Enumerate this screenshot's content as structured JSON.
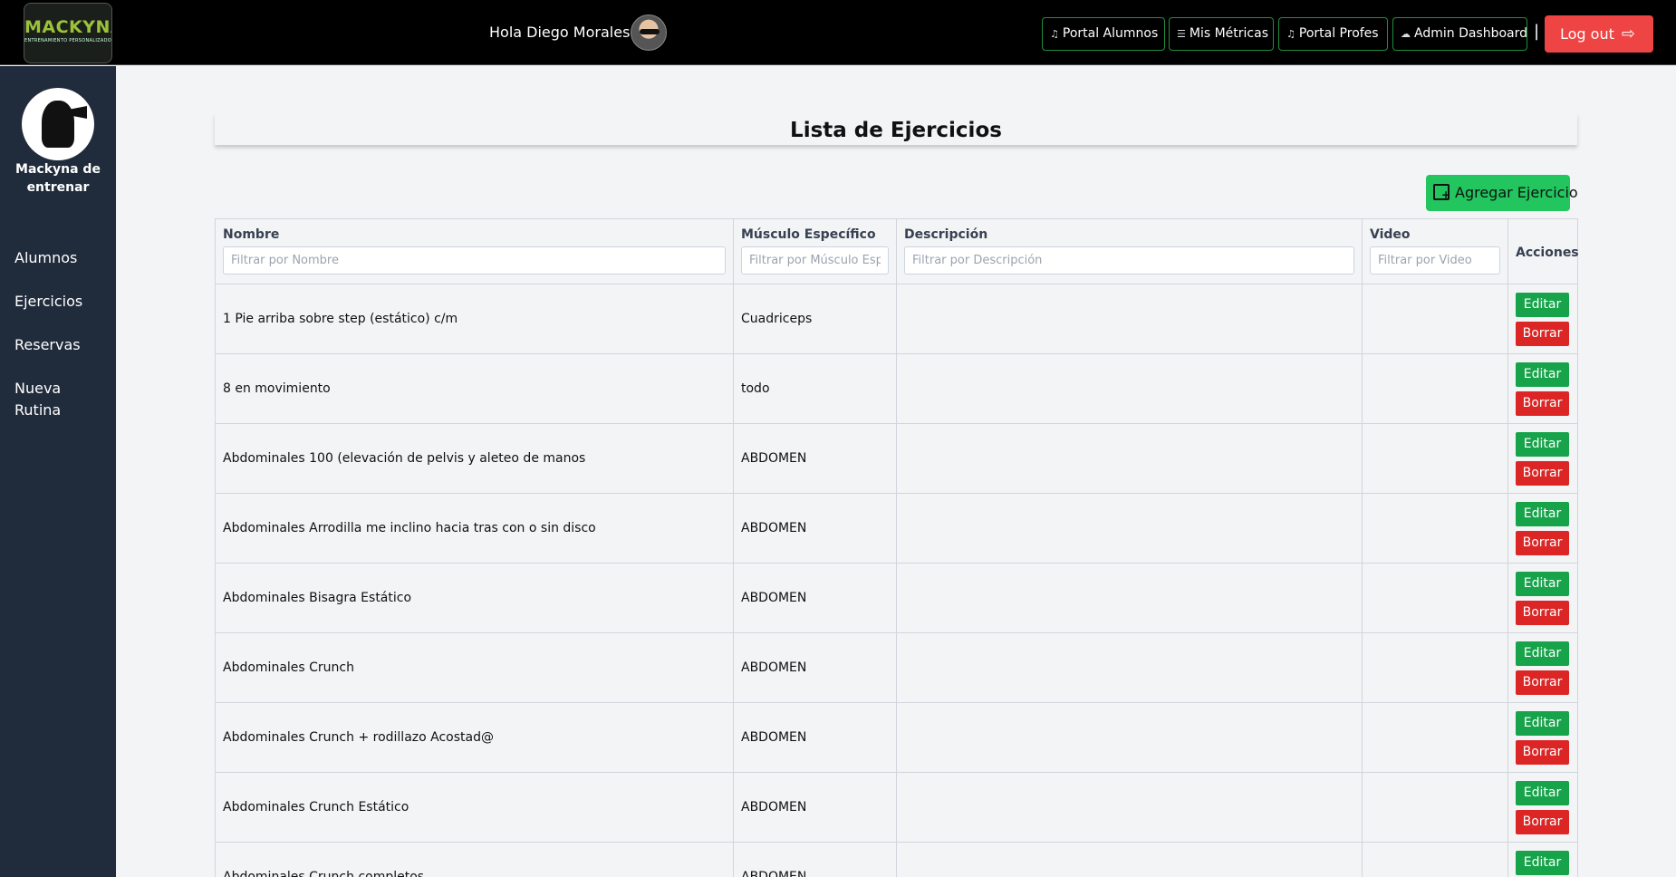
{
  "header": {
    "logo_text": "MACKYNA",
    "logo_tagline": "ENTRENAMIENTO PERSONALIZADO",
    "greeting": "Hola Diego Morales!",
    "nav": [
      {
        "label": "Portal Alumnos",
        "icon": "music-note-icon"
      },
      {
        "label": "Mis Métricas",
        "icon": "menu-lines-icon"
      },
      {
        "label": "Portal Profes",
        "icon": "music-note-icon"
      },
      {
        "label": "Admin Dashboard",
        "icon": "cloud-icon"
      }
    ],
    "separator": "|",
    "logout_label": "Log out",
    "colors": {
      "accent_green": "#1f8f3d",
      "logout": "#ef4444"
    }
  },
  "sidebar": {
    "name": "Mackyna de entrenar",
    "items": [
      {
        "label": "Alumnos"
      },
      {
        "label": "Ejercicios"
      },
      {
        "label": "Reservas"
      },
      {
        "label": "Nueva Rutina"
      }
    ]
  },
  "main": {
    "title": "Lista de Ejercicios",
    "add_label": "Agregar Ejercicio",
    "columns": [
      {
        "label": "Nombre",
        "placeholder": "Filtrar por Nombre"
      },
      {
        "label": "Músculo Específico",
        "placeholder": "Filtrar por Músculo Específico"
      },
      {
        "label": "Descripción",
        "placeholder": "Filtrar por Descripción"
      },
      {
        "label": "Video",
        "placeholder": "Filtrar por Video"
      },
      {
        "label": "Acciones"
      }
    ],
    "edit_label": "Editar",
    "delete_label": "Borrar",
    "rows": [
      {
        "nombre": "1 Pie arriba sobre step (estático) c/m",
        "musculo": "Cuadriceps",
        "descripcion": "",
        "video": ""
      },
      {
        "nombre": "8 en movimiento",
        "musculo": "todo",
        "descripcion": "",
        "video": ""
      },
      {
        "nombre": "Abdominales 100 (elevación de pelvis y aleteo de manos",
        "musculo": "ABDOMEN",
        "descripcion": "",
        "video": ""
      },
      {
        "nombre": "Abdominales Arrodilla me inclino hacia tras con o sin disco",
        "musculo": "ABDOMEN",
        "descripcion": "",
        "video": ""
      },
      {
        "nombre": "Abdominales Bisagra Estático",
        "musculo": "ABDOMEN",
        "descripcion": "",
        "video": ""
      },
      {
        "nombre": "Abdominales Crunch",
        "musculo": "ABDOMEN",
        "descripcion": "",
        "video": ""
      },
      {
        "nombre": "Abdominales Crunch + rodillazo Acostad@",
        "musculo": "ABDOMEN",
        "descripcion": "",
        "video": ""
      },
      {
        "nombre": "Abdominales Crunch Estático",
        "musculo": "ABDOMEN",
        "descripcion": "",
        "video": ""
      },
      {
        "nombre": "Abdominales Crunch completos",
        "musculo": "ABDOMEN",
        "descripcion": "",
        "video": ""
      }
    ]
  }
}
